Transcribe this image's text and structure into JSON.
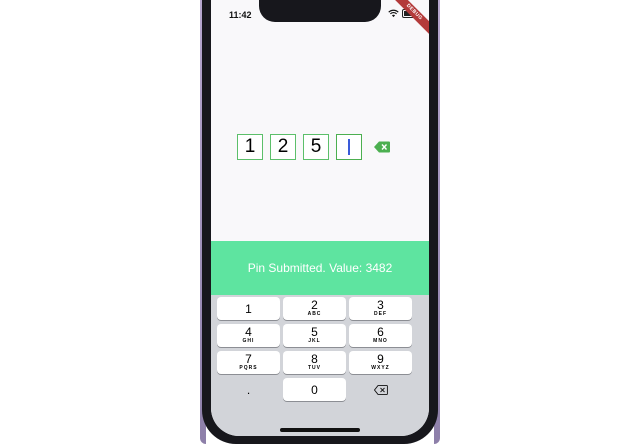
{
  "status_bar": {
    "time": "11:42",
    "debug_label": "DEBUG"
  },
  "pin": {
    "digits": [
      "1",
      "2",
      "5",
      ""
    ]
  },
  "snackbar": {
    "message": "Pin Submitted. Value: 3482"
  },
  "keyboard": {
    "keys": [
      {
        "num": "1",
        "letters": ""
      },
      {
        "num": "2",
        "letters": "ABC"
      },
      {
        "num": "3",
        "letters": "DEF"
      },
      {
        "num": "4",
        "letters": "GHI"
      },
      {
        "num": "5",
        "letters": "JKL"
      },
      {
        "num": "6",
        "letters": "MNO"
      },
      {
        "num": "7",
        "letters": "PQRS"
      },
      {
        "num": "8",
        "letters": "TUV"
      },
      {
        "num": "9",
        "letters": "WXYZ"
      },
      {
        "num": ".",
        "letters": ""
      },
      {
        "num": "0",
        "letters": ""
      }
    ]
  },
  "colors": {
    "accent": "#5cbf6a",
    "snackbar": "#5ee4a0",
    "cursor": "#3a5bd9"
  }
}
